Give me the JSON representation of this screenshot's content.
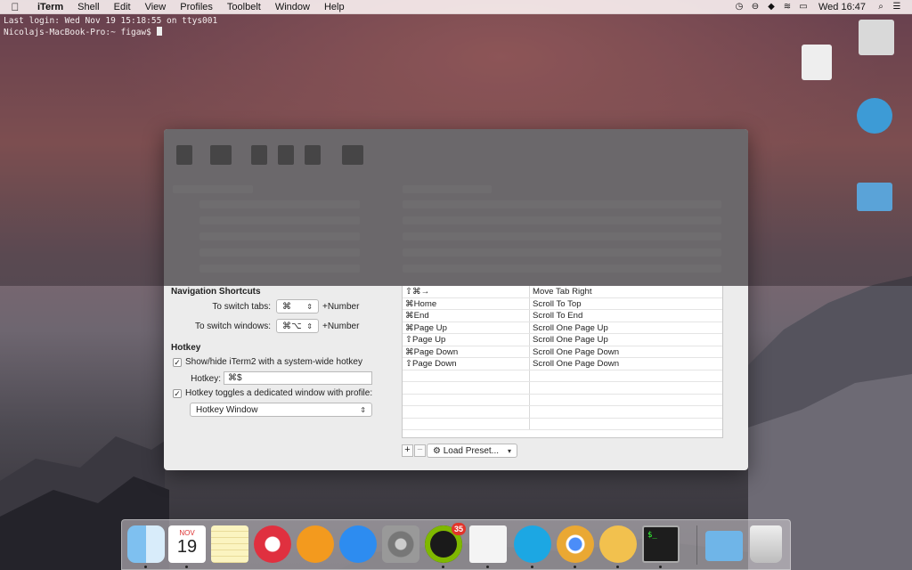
{
  "menubar": {
    "apple_icon": "apple-icon",
    "items": [
      "iTerm",
      "Shell",
      "Edit",
      "View",
      "Profiles",
      "Toolbelt",
      "Window",
      "Help"
    ],
    "status_icons": [
      "clock-icon",
      "sync-icon",
      "dropbox-icon",
      "wifi-icon",
      "battery-icon"
    ],
    "clock": "Wed 16:47",
    "search_icon": "search-icon",
    "list_icon": "list-icon"
  },
  "terminal": {
    "line1": "Last login: Wed Nov 19 15:18:55 on ttys001",
    "prompt": "Nicolajs-MacBook-Pro:~ figaw$"
  },
  "prefs": {
    "navigation_title": "Navigation Shortcuts",
    "switch_tabs_label": "To switch tabs:",
    "switch_tabs_value": "⌘",
    "switch_tabs_suffix": "+Number",
    "switch_windows_label": "To switch windows:",
    "switch_windows_value": "⌘⌥",
    "switch_windows_suffix": "+Number",
    "hotkey_title": "Hotkey",
    "show_hide_label": "Show/hide iTerm2 with a system-wide hotkey",
    "hotkey_label": "Hotkey:",
    "hotkey_value": "⌘$",
    "dedicated_label": "Hotkey toggles a dedicated window with profile:",
    "profile_value": "Hotkey Window",
    "check_mark": "✓",
    "add_label": "+",
    "remove_label": "−",
    "load_preset_label": "Load Preset...",
    "gear_icon": "gear-icon"
  },
  "keys": [
    {
      "key": "⇧⌘→",
      "action": "Move Tab Right"
    },
    {
      "key": "⌘Home",
      "action": "Scroll To Top"
    },
    {
      "key": "⌘End",
      "action": "Scroll To End"
    },
    {
      "key": "⌘Page Up",
      "action": "Scroll One Page Up"
    },
    {
      "key": "⇧Page Up",
      "action": "Scroll One Page Up"
    },
    {
      "key": "⌘Page Down",
      "action": "Scroll One Page Down"
    },
    {
      "key": "⇧Page Down",
      "action": "Scroll One Page Down"
    },
    {
      "key": "",
      "action": ""
    },
    {
      "key": "",
      "action": ""
    },
    {
      "key": "",
      "action": ""
    },
    {
      "key": "",
      "action": ""
    },
    {
      "key": "",
      "action": ""
    }
  ],
  "dock": {
    "calendar_month": "NOV",
    "calendar_day": "19",
    "spotify_badge": "35",
    "apps": [
      "finder",
      "calendar",
      "notes",
      "itunes",
      "ibooks",
      "app-store",
      "system-preferences",
      "spotify",
      "textedit",
      "skype",
      "chrome",
      "wunderlist",
      "terminal",
      "downloads-folder",
      "trash"
    ]
  }
}
